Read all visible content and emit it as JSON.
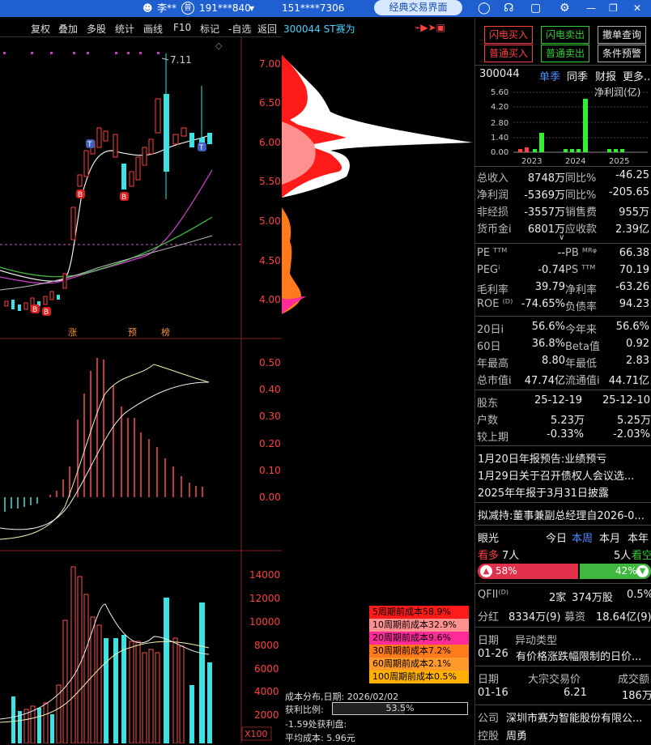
{
  "topbar": {
    "user": "李**",
    "account1": "191***840",
    "account2": "151****7306",
    "mode_button": "经典交易界面"
  },
  "toolbar": {
    "items": [
      "复权",
      "叠加",
      "多股",
      "统计",
      "画线",
      "F10",
      "标记",
      "-自选",
      "返回"
    ]
  },
  "chart": {
    "stock_title": "300044 ST赛为",
    "price_axis": [
      "7.00",
      "6.50",
      "6.00",
      "5.50",
      "5.00",
      "4.50",
      "4.00"
    ],
    "high_label": "7.11",
    "tags": [
      "涨",
      "预",
      "榜"
    ],
    "macd_axis": [
      "0.50",
      "0.40",
      "0.30",
      "0.20",
      "0.10",
      "0.00"
    ],
    "vol_axis": [
      "14000",
      "12000",
      "10000",
      "8000",
      "6000",
      "4000",
      "2000"
    ],
    "vol_unit": "X100"
  },
  "cost": {
    "legend": [
      "5周期前成本58.9%",
      "10周期前成本32.9%",
      "20周期前成本9.6%",
      "30周期前成本7.2%",
      "60周期前成本2.1%",
      "100周期前成本0.5%"
    ],
    "legend_colors": [
      "#ff1a1a",
      "#ff9090",
      "#ff2a9a",
      "#ff7a1a",
      "#ff9a2a",
      "#ffb000"
    ],
    "date_line": "成本分布,日期: 2026/02/02",
    "profit_label": "获利比例:",
    "profit_pct": "53.5%",
    "profit_ratio": 0.535,
    "curve_label": "-1.59处获利盘:",
    "avg_label": "平均成本: 5.96元"
  },
  "trade": {
    "fast_buy": "闪电买入",
    "fast_sell": "闪电卖出",
    "cancel": "撤单查询",
    "normal_buy": "普通买入",
    "normal_sell": "普通卖出",
    "cond": "条件预警"
  },
  "finance": {
    "code": "300044",
    "tabs": [
      "单季",
      "同季",
      "财报",
      "更多.."
    ],
    "chart_title": "净利润(亿)",
    "yaxis": [
      "5.60",
      "4.20",
      "2.80",
      "1.40",
      "0.00"
    ],
    "years": [
      "2023",
      "2024",
      "2025"
    ],
    "rows": [
      [
        "总收入",
        "8748万",
        "同比%",
        "-46.25"
      ],
      [
        "净利润",
        "-5369万",
        "同比%",
        "-205.65"
      ],
      [
        "非经损",
        "-3557万",
        "销售费",
        "955万"
      ],
      [
        "货币金i",
        "6801万",
        "应收款",
        "2.39亿"
      ]
    ],
    "rows2": [
      [
        "PE ᵀᵀᴹ",
        "--",
        "PB ᴹᴿᵠ",
        "66.38"
      ],
      [
        "PEGⁱ",
        "-0.74",
        "PS ᵀᵀᴹ",
        "70.19"
      ],
      [
        "毛利率",
        "39.79",
        "净利率",
        "-63.26"
      ],
      [
        "ROE ⁽ᴰ⁾",
        "-74.65%",
        "负债率",
        "94.23"
      ]
    ],
    "rows3": [
      [
        "20日i",
        "56.6%",
        "今年来",
        "56.6%"
      ],
      [
        "60日",
        "36.8%",
        "Beta值",
        "0.92"
      ],
      [
        "年最高",
        "8.80",
        "年最低",
        "2.83"
      ],
      [
        "总市值i",
        "47.74亿",
        "流通值i",
        "44.71亿"
      ]
    ],
    "holders": [
      [
        "股东",
        "25-12-19",
        "25-12-10"
      ],
      [
        "户数",
        "5.23万",
        "5.25万"
      ],
      [
        "较上期",
        "-0.33%",
        "-2.03%"
      ]
    ],
    "news": [
      "1月20日年报预告:业绩预亏",
      "1月29日关于召开债权人会议选...",
      "2025年年报于3月31日披露"
    ],
    "reduce": "拟减持:董事兼副总经理自2026-0...",
    "eye": {
      "label": "眼光",
      "tabs": [
        "今日",
        "本周",
        "本月",
        "本年"
      ],
      "bull": "看多",
      "bull_n": "7人",
      "bear_n": "5人",
      "bear": "看空",
      "bull_pct": "58%",
      "bear_pct": "42%"
    },
    "qfii": [
      "QFII⁽ᴰ⁾",
      "2家",
      "374万股",
      "0.5%"
    ],
    "fenhong": [
      "分红",
      "8334万(9)",
      "募资",
      "18.64亿(9)"
    ],
    "abn": [
      "日期",
      "异动类型",
      "01-26",
      "有价格涨跌幅限制的日价..."
    ],
    "block": [
      "日期",
      "大宗交易价",
      "成交额",
      "01-16",
      "6.21",
      "186万"
    ],
    "company": [
      "公司",
      "深圳市赛为智能股份有限公..."
    ],
    "control": [
      "控股",
      "周勇"
    ]
  }
}
